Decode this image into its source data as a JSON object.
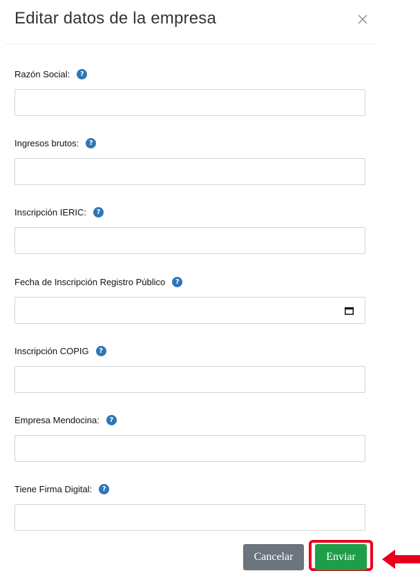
{
  "modal": {
    "title": "Editar datos de la empresa",
    "close_symbol": "×"
  },
  "fields": [
    {
      "label": "Razón Social:",
      "value": "",
      "type": "text",
      "help_icon": "question-circle-icon"
    },
    {
      "label": "Ingresos brutos:",
      "value": "",
      "type": "text",
      "help_icon": "question-circle-icon"
    },
    {
      "label": "Inscripción IERIC:",
      "value": "",
      "type": "text",
      "help_icon": "question-circle-icon"
    },
    {
      "label": "Fecha de Inscripción Registro Público",
      "value": "",
      "type": "date",
      "help_icon": "question-circle-icon"
    },
    {
      "label": "Inscripción COPIG",
      "value": "",
      "type": "text",
      "help_icon": "question-circle-icon"
    },
    {
      "label": "Empresa Mendocina:",
      "value": "",
      "type": "text",
      "help_icon": "question-circle-icon"
    },
    {
      "label": "Tiene Firma Digital:",
      "value": "",
      "type": "text",
      "help_icon": "question-circle-icon"
    }
  ],
  "help_icon_glyph": "?",
  "footer": {
    "cancel_label": "Cancelar",
    "submit_label": "Enviar"
  },
  "colors": {
    "help_icon": "#2e75b6",
    "cancel_button": "#6c757d",
    "submit_button": "#1f9e4a",
    "annotation_highlight": "#e8001a"
  },
  "annotation": {
    "highlight_target": "submit-button",
    "arrow_direction": "left"
  }
}
